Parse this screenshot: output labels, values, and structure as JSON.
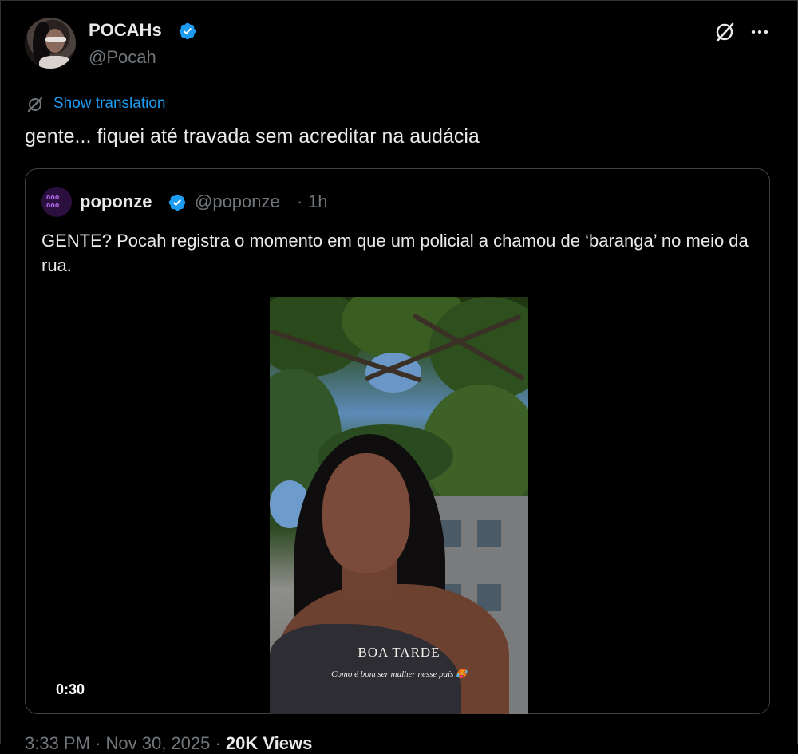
{
  "post": {
    "display_name": "POCAHs",
    "handle": "@Pocah",
    "show_translation": "Show translation",
    "text": "gente... fiquei até travada sem acreditar na audácia",
    "verified_color": "#1d9bf0"
  },
  "quote": {
    "display_name": "poponze",
    "handle": "@poponze",
    "separator": "·",
    "time": "1h",
    "text": "GENTE? Pocah registra o momento em que um policial a chamou de ‘baranga’ no meio da rua.",
    "video": {
      "duration": "0:30",
      "caption_title": "BOA TARDE",
      "caption_sub": "Como é bom ser mulher nesse país 🥵"
    }
  },
  "footer": {
    "timestamp": "3:33 PM · Nov 30, 2025 ·",
    "views_label": "20K Views"
  },
  "icons": {
    "header_right": [
      "grok-icon",
      "more-icon"
    ],
    "translation": "translate-icon",
    "verified": "verified-badge-icon"
  }
}
